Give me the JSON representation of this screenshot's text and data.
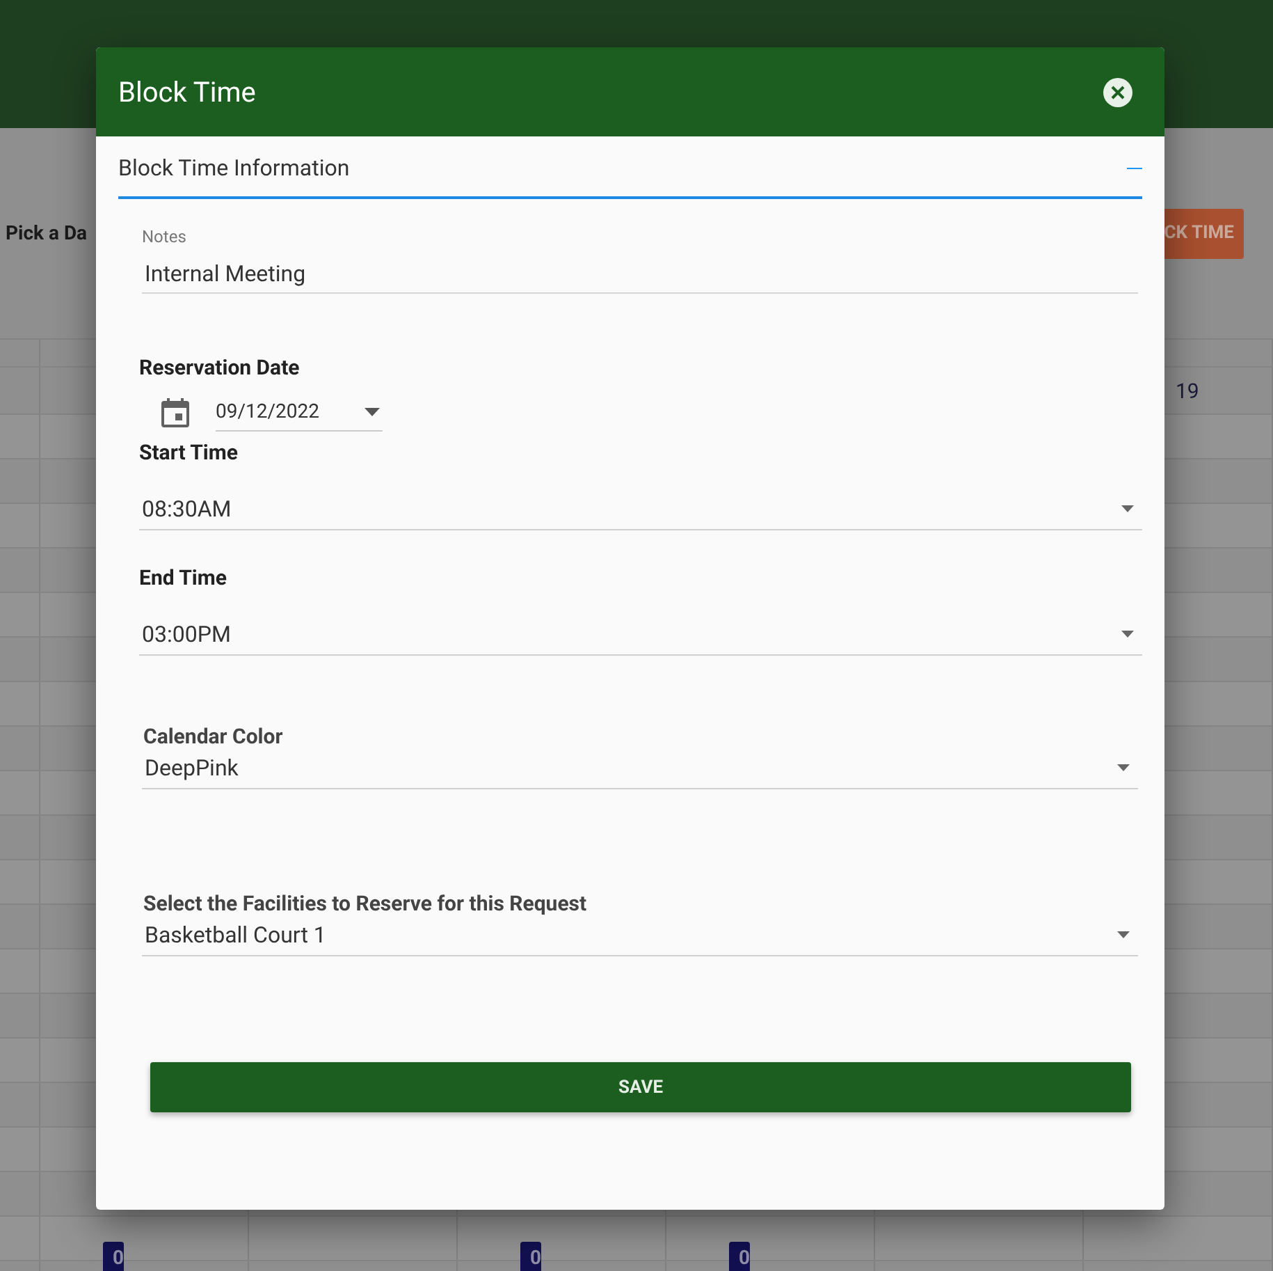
{
  "background": {
    "date_label": "Pick a Da",
    "action_button": "CK TIME",
    "day_number": "19",
    "badges": [
      "0",
      "0",
      "0"
    ]
  },
  "dialog": {
    "title": "Block Time",
    "section": {
      "title": "Block Time Information",
      "expanded": true
    },
    "notes": {
      "label": "Notes",
      "value": "Internal Meeting"
    },
    "reservation_date": {
      "label": "Reservation Date",
      "value": "09/12/2022"
    },
    "start_time": {
      "label": "Start Time",
      "value": "08:30AM"
    },
    "end_time": {
      "label": "End Time",
      "value": "03:00PM"
    },
    "calendar_color": {
      "label": "Calendar Color",
      "value": "DeepPink"
    },
    "facilities": {
      "label": "Select the Facilities to Reserve for this Request",
      "value": "Basketball Court 1"
    },
    "save_button": "SAVE"
  }
}
